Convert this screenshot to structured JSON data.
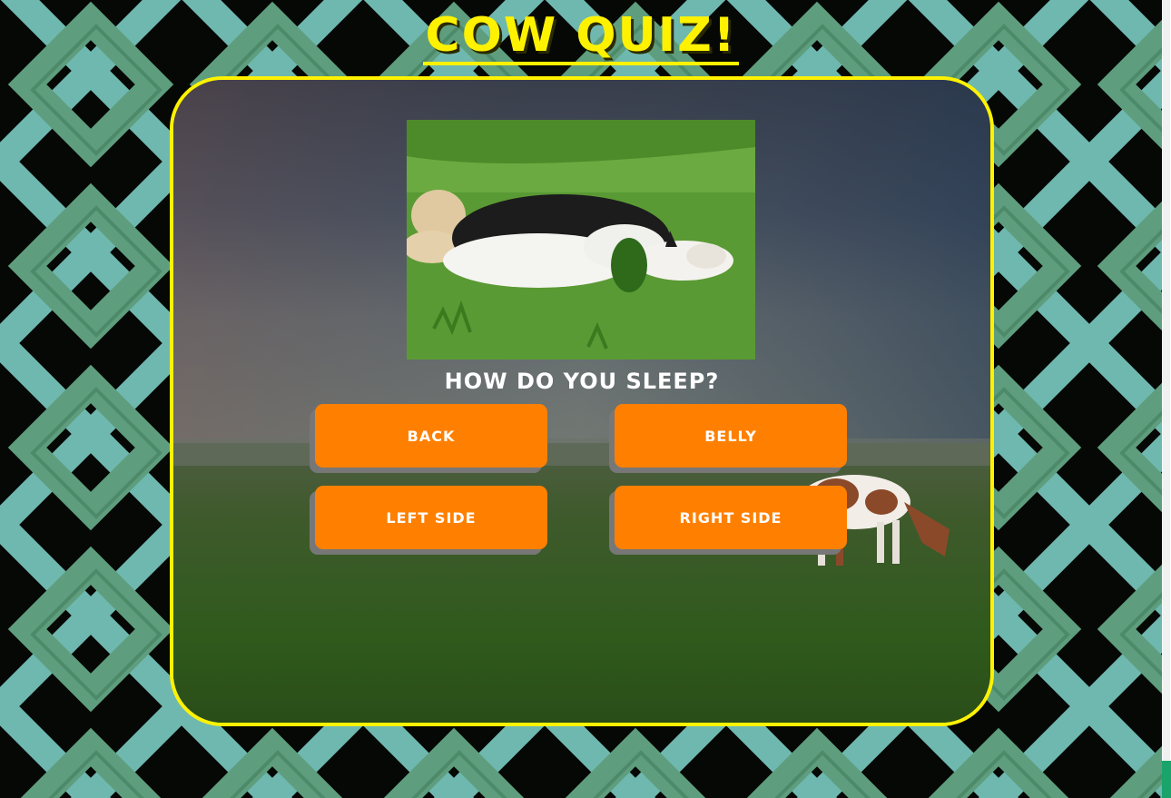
{
  "header": {
    "title": "COW QUIZ!"
  },
  "quiz": {
    "question": "How do you sleep?",
    "image_subject": "cow sleeping on its side in green grass",
    "answers": [
      {
        "label": "Back"
      },
      {
        "label": "Belly"
      },
      {
        "label": "Left side"
      },
      {
        "label": "Right side"
      }
    ]
  },
  "colors": {
    "accent": "#fff200",
    "button": "#ff8000",
    "button_shadow": "#777777",
    "pattern_teal": "#6fb8b0",
    "pattern_green": "#5e9e7e",
    "background": "#050805"
  }
}
